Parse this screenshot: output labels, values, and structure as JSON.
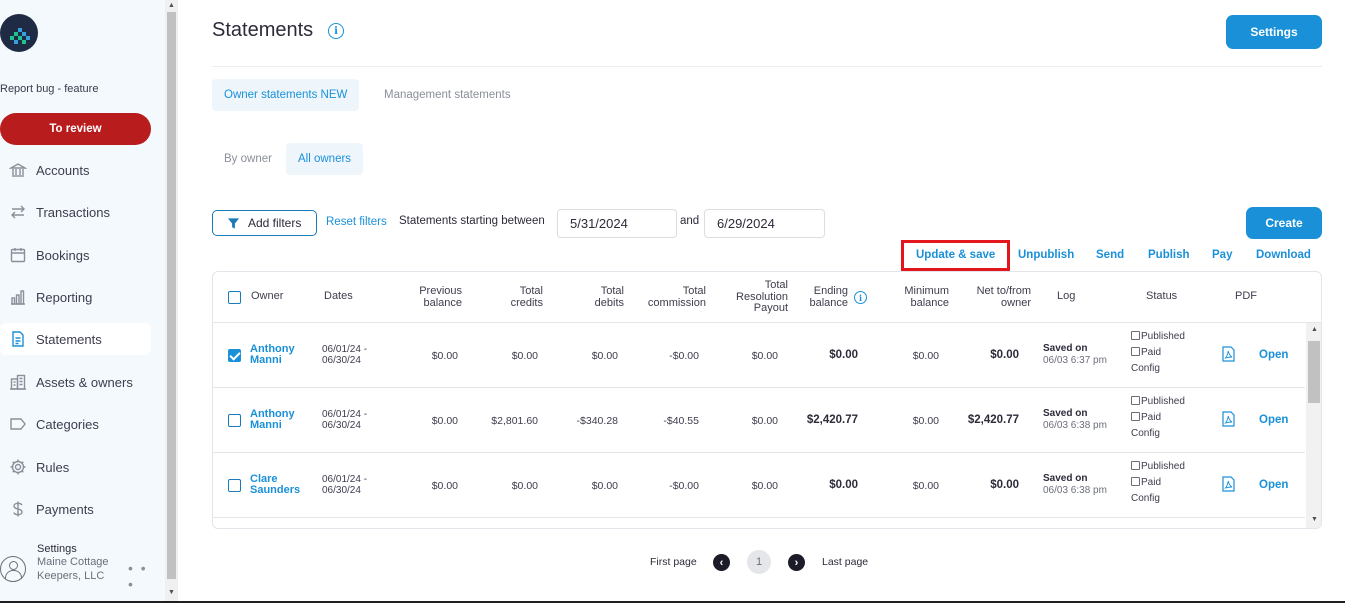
{
  "sidebar": {
    "report_bug": "Report bug - feature",
    "to_review": "To review",
    "items": [
      {
        "label": "Accounts",
        "icon": "bank-icon"
      },
      {
        "label": "Transactions",
        "icon": "transfer-arrows-icon"
      },
      {
        "label": "Bookings",
        "icon": "calendar-icon"
      },
      {
        "label": "Reporting",
        "icon": "bar-chart-icon"
      },
      {
        "label": "Statements",
        "icon": "document-icon",
        "active": true
      },
      {
        "label": "Assets & owners",
        "icon": "buildings-icon"
      },
      {
        "label": "Categories",
        "icon": "tag-icon"
      },
      {
        "label": "Rules",
        "icon": "gear-icon"
      },
      {
        "label": "Payments",
        "icon": "dollar-icon"
      }
    ],
    "settings": {
      "title": "Settings",
      "org": "Maine Cottage Keepers, LLC",
      "more": "• • •"
    }
  },
  "header": {
    "title": "Statements",
    "info": "i",
    "settings_button": "Settings"
  },
  "tabs": [
    {
      "label": "Owner statements NEW",
      "active": true
    },
    {
      "label": "Management statements",
      "active": false
    }
  ],
  "subtabs": [
    {
      "label": "By owner",
      "active": false
    },
    {
      "label": "All owners",
      "active": true
    }
  ],
  "filters": {
    "add_filters": "Add filters",
    "reset_filters": "Reset filters",
    "between_label": "Statements starting between",
    "start_date": "5/31/2024",
    "and_label": "and",
    "end_date": "6/29/2024"
  },
  "create_button": "Create",
  "actions": [
    "Update & save",
    "Unpublish",
    "Send",
    "Publish",
    "Pay",
    "Download"
  ],
  "table": {
    "headers": {
      "owner": "Owner",
      "dates": "Dates",
      "previous_balance": "Previous balance",
      "total_credits": "Total credits",
      "total_debits": "Total debits",
      "total_commission": "Total commission",
      "total_resolution_payout": "Total Resolution Payout",
      "ending_balance": "Ending balance",
      "minimum_balance": "Minimum balance",
      "net_to_from_owner": "Net to/from owner",
      "log": "Log",
      "status": "Status",
      "pdf": "PDF"
    },
    "rows": [
      {
        "checked": true,
        "owner": "Anthony Manni",
        "dates": "06/01/24 - 06/30/24",
        "previous_balance": "$0.00",
        "total_credits": "$0.00",
        "total_debits": "$0.00",
        "total_commission": "-$0.00",
        "total_resolution_payout": "$0.00",
        "ending_balance": "$0.00",
        "minimum_balance": "$0.00",
        "net": "$0.00",
        "log_title": "Saved on",
        "log_date": "06/03 6:37 pm",
        "status_published": "Published",
        "status_paid": "Paid",
        "status_config": "Config",
        "open": "Open"
      },
      {
        "checked": false,
        "owner": "Anthony Manni",
        "dates": "06/01/24 - 06/30/24",
        "previous_balance": "$0.00",
        "total_credits": "$2,801.60",
        "total_debits": "-$340.28",
        "total_commission": "-$40.55",
        "total_resolution_payout": "$0.00",
        "ending_balance": "$2,420.77",
        "minimum_balance": "$0.00",
        "net": "$2,420.77",
        "log_title": "Saved on",
        "log_date": "06/03 6:38 pm",
        "status_published": "Published",
        "status_paid": "Paid",
        "status_config": "Config",
        "open": "Open"
      },
      {
        "checked": false,
        "owner": "Clare Saunders",
        "dates": "06/01/24 - 06/30/24",
        "previous_balance": "$0.00",
        "total_credits": "$0.00",
        "total_debits": "$0.00",
        "total_commission": "-$0.00",
        "total_resolution_payout": "$0.00",
        "ending_balance": "$0.00",
        "minimum_balance": "$0.00",
        "net": "$0.00",
        "log_title": "Saved on",
        "log_date": "06/03 6:38 pm",
        "status_published": "Published",
        "status_paid": "Paid",
        "status_config": "Config",
        "open": "Open"
      }
    ]
  },
  "pagination": {
    "first": "First page",
    "current": "1",
    "last": "Last page"
  },
  "colors": {
    "accent": "#1a90d9",
    "review": "#b91c1c",
    "highlight": "#e3161e"
  }
}
